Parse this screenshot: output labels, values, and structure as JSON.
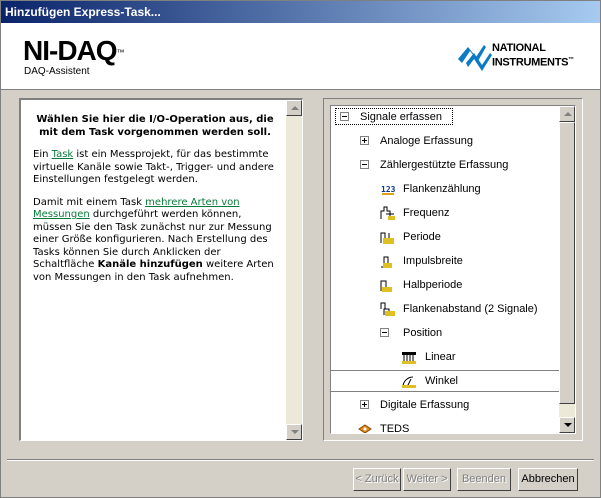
{
  "window": {
    "title": "Hinzufügen Express-Task..."
  },
  "header": {
    "product": "NI-DAQ",
    "product_tm": "™",
    "subtitle": "DAQ-Assistent",
    "logo_line1": "NATIONAL",
    "logo_line2": "INSTRUMENTS",
    "logo_tm": "™"
  },
  "help": {
    "lead": "Wählen Sie hier die I/O-Operation aus, die mit dem Task vorgenommen werden soll.",
    "p1_pre": "Ein ",
    "p1_link": "Task",
    "p1_post": " ist ein Messprojekt, für das bestimmte virtuelle Kanäle sowie Takt-, Trigger- und andere Einstellungen festgelegt werden.",
    "p2_pre": "Damit mit einem Task ",
    "p2_link": "mehrere Arten von Messungen",
    "p2_mid": " durchgeführt werden können, müssen Sie den Task zunächst nur zur Messung einer Größe konfigurieren. Nach Erstellung des Tasks können Sie durch Anklicken der Schaltfläche ",
    "p2_bold": "Kanäle hinzufügen",
    "p2_post": " weitere Arten von Messungen in den Task aufnehmen."
  },
  "tree": {
    "root": "Signale erfassen",
    "analog": "Analoge Erfassung",
    "counter": "Zählergestützte Erfassung",
    "edge_count": "Flankenzählung",
    "frequency": "Frequenz",
    "period": "Periode",
    "pulse_width": "Impulsbreite",
    "semi_period": "Halbperiode",
    "two_edge": "Flankenabstand (2 Signale)",
    "position": "Position",
    "linear": "Linear",
    "angular": "Winkel",
    "digital": "Digitale Erfassung",
    "teds": "TEDS"
  },
  "buttons": {
    "back": "< Zurück",
    "next": "Weiter >",
    "finish": "Beenden",
    "cancel": "Abbrechen"
  }
}
